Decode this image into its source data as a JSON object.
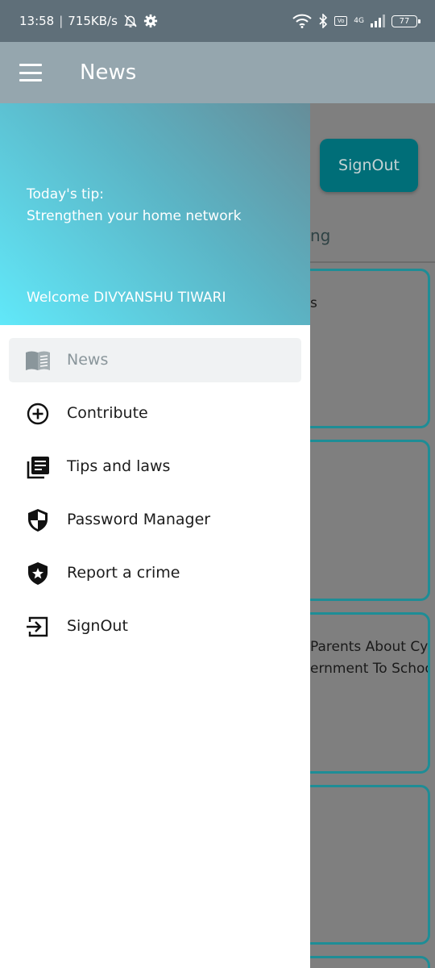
{
  "status_bar": {
    "time": "13:58",
    "speed": "715KB/s",
    "network_label": "4G",
    "volte": "VoLTE",
    "battery": "77"
  },
  "app_bar": {
    "title": "News",
    "menu_icon": "hamburger-menu-icon"
  },
  "background": {
    "signout_label": "SignOut",
    "tab_text": "ng",
    "cards": [
      {
        "lines": [
          "s"
        ]
      },
      {
        "lines": []
      },
      {
        "lines": [
          "Parents About Cy",
          "ernment To Schoo"
        ]
      },
      {
        "lines": []
      }
    ]
  },
  "drawer": {
    "header": {
      "tip_label": "Today's tip:",
      "tip_text": "Strengthen your home network",
      "welcome": "Welcome DIVYANSHU TIWARI",
      "gradient_colors": [
        "#61e8f9",
        "#5bb5c6",
        "#668d99"
      ]
    },
    "items": [
      {
        "label": "News",
        "icon": "book-open-icon",
        "active": true
      },
      {
        "label": "Contribute",
        "icon": "add-circle-icon",
        "active": false
      },
      {
        "label": "Tips and laws",
        "icon": "library-books-icon",
        "active": false
      },
      {
        "label": "Password Manager",
        "icon": "shield-icon",
        "active": false
      },
      {
        "label": "Report a crime",
        "icon": "police-badge-icon",
        "active": false
      },
      {
        "label": "SignOut",
        "icon": "exit-icon",
        "active": false
      }
    ]
  },
  "colors": {
    "accent": "#006e78",
    "card_border": "#1e8d96",
    "scrim": "#7f7f7f",
    "active_item_bg": "#f0f2f3"
  }
}
